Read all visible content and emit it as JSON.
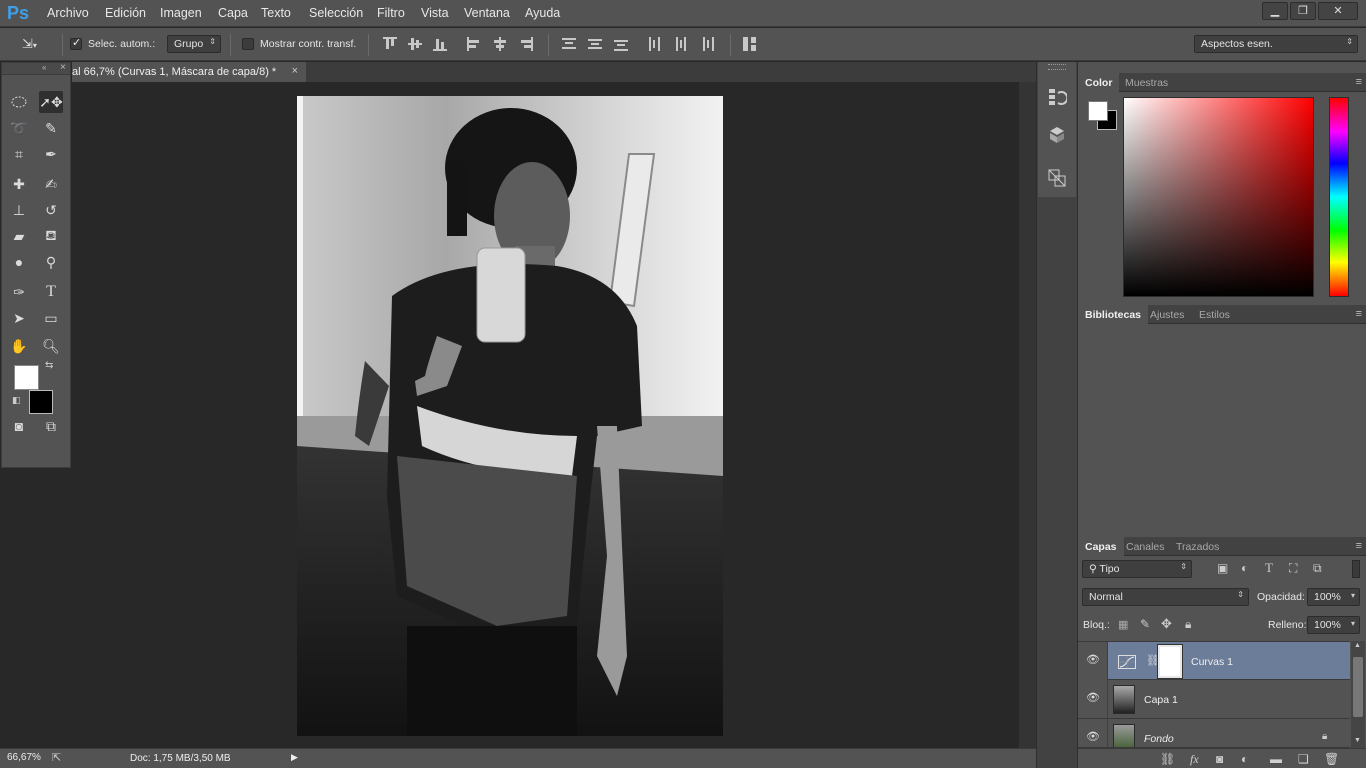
{
  "app": {
    "logo": "Ps"
  },
  "menu": [
    "Archivo",
    "Edición",
    "Imagen",
    "Capa",
    "Texto",
    "Selección",
    "Filtro",
    "Vista",
    "Ventana",
    "Ayuda"
  ],
  "window_controls": [
    "minimize-icon",
    "restore-icon",
    "close-icon"
  ],
  "options": {
    "auto_select_label": "Selec. autom.:",
    "auto_select_checked": true,
    "group_value": "Grupo",
    "show_transform_label": "Mostrar contr. transf.",
    "show_transform_checked": false,
    "workspace_value": "Aspectos esen."
  },
  "document": {
    "tab_title": "al 66,7% (Curvas 1, Máscara de capa/8) *",
    "close_glyph": "×"
  },
  "status": {
    "zoom": "66,67%",
    "doc_info": "Doc: 1,75 MB/3,50 MB"
  },
  "color_panel": {
    "tabs": [
      "Color",
      "Muestras"
    ],
    "active_tab": "Color",
    "hue_accent": "#ff0000"
  },
  "libraries_panel": {
    "tabs": [
      "Bibliotecas",
      "Ajustes",
      "Estilos"
    ],
    "active_tab": "Bibliotecas"
  },
  "layers_panel": {
    "tabs": [
      "Capas",
      "Canales",
      "Trazados"
    ],
    "active_tab": "Capas",
    "filter_value": "Tipo",
    "blend_mode": "Normal",
    "opacity_label": "Opacidad:",
    "opacity_value": "100%",
    "lock_label": "Bloq.:",
    "fill_label": "Relleno:",
    "fill_value": "100%",
    "layers": [
      {
        "name": "Curvas 1",
        "selected": true,
        "type": "adjustment",
        "visible": true
      },
      {
        "name": "Capa 1",
        "selected": false,
        "type": "pixel",
        "visible": true
      },
      {
        "name": "Fondo",
        "selected": false,
        "type": "background",
        "visible": true,
        "locked": true
      }
    ],
    "selection_color": "#6b7d99"
  },
  "foreground_color": "#ffffff",
  "background_color": "#000000"
}
